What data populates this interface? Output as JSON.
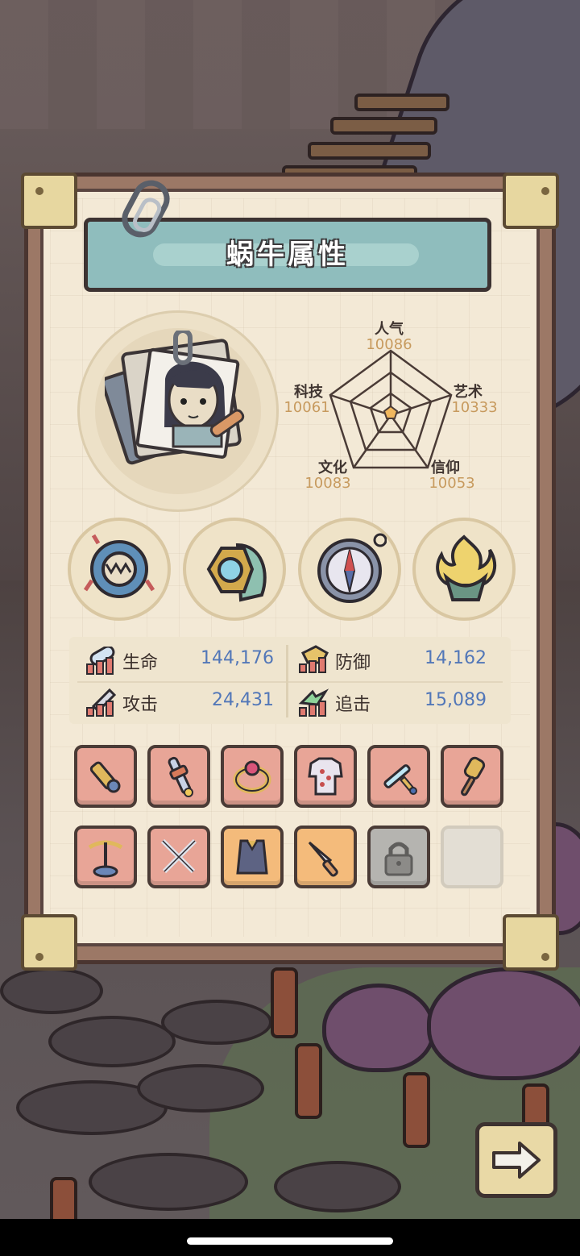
{
  "title": "蜗牛属性",
  "radar": {
    "stats": [
      {
        "name": "人气",
        "value": "10086"
      },
      {
        "name": "艺术",
        "value": "10333"
      },
      {
        "name": "信仰",
        "value": "10053"
      },
      {
        "name": "文化",
        "value": "10083"
      },
      {
        "name": "科技",
        "value": "10061"
      }
    ]
  },
  "relics": [
    {
      "icon": "monster-ring-icon"
    },
    {
      "icon": "gem-shell-icon"
    },
    {
      "icon": "compass-icon"
    },
    {
      "icon": "golden-flame-icon"
    }
  ],
  "attributes": [
    {
      "label": "生命",
      "value": "144,176",
      "icon": "health-icon"
    },
    {
      "label": "防御",
      "value": "14,162",
      "icon": "defense-icon"
    },
    {
      "label": "攻击",
      "value": "24,431",
      "icon": "attack-icon"
    },
    {
      "label": "追击",
      "value": "15,089",
      "icon": "pursuit-icon"
    }
  ],
  "inventory": [
    {
      "slot": "1",
      "state": "filled",
      "rarity": "red",
      "icon": "cannon-icon"
    },
    {
      "slot": "2",
      "state": "filled",
      "rarity": "red",
      "icon": "scepter-icon"
    },
    {
      "slot": "3",
      "state": "filled",
      "rarity": "red",
      "icon": "ring-icon"
    },
    {
      "slot": "4",
      "state": "filled",
      "rarity": "red",
      "icon": "armor-icon"
    },
    {
      "slot": "5",
      "state": "filled",
      "rarity": "red",
      "icon": "sword-icon"
    },
    {
      "slot": "6",
      "state": "filled",
      "rarity": "red",
      "icon": "mace-icon"
    },
    {
      "slot": "7",
      "state": "filled",
      "rarity": "red",
      "icon": "crossbow-icon"
    },
    {
      "slot": "8",
      "state": "filled",
      "rarity": "red",
      "icon": "crossed-swords-icon"
    },
    {
      "slot": "9",
      "state": "filled",
      "rarity": "orange",
      "icon": "vest-icon"
    },
    {
      "slot": "10",
      "state": "filled",
      "rarity": "orange",
      "icon": "dagger-icon"
    },
    {
      "slot": "11",
      "state": "locked",
      "rarity": "gray",
      "icon": "lock-icon"
    },
    {
      "slot": "12",
      "state": "empty",
      "rarity": "none",
      "icon": ""
    }
  ],
  "next_button": {
    "icon": "arrow-right-icon"
  },
  "colors": {
    "panel_bg": "#f3e9d6",
    "title_bar": "#8fbdbd",
    "stat_value": "#c79a5e",
    "attr_value": "#5277b8",
    "slot_red": "#e8a597",
    "slot_orange": "#f4bb7b"
  }
}
